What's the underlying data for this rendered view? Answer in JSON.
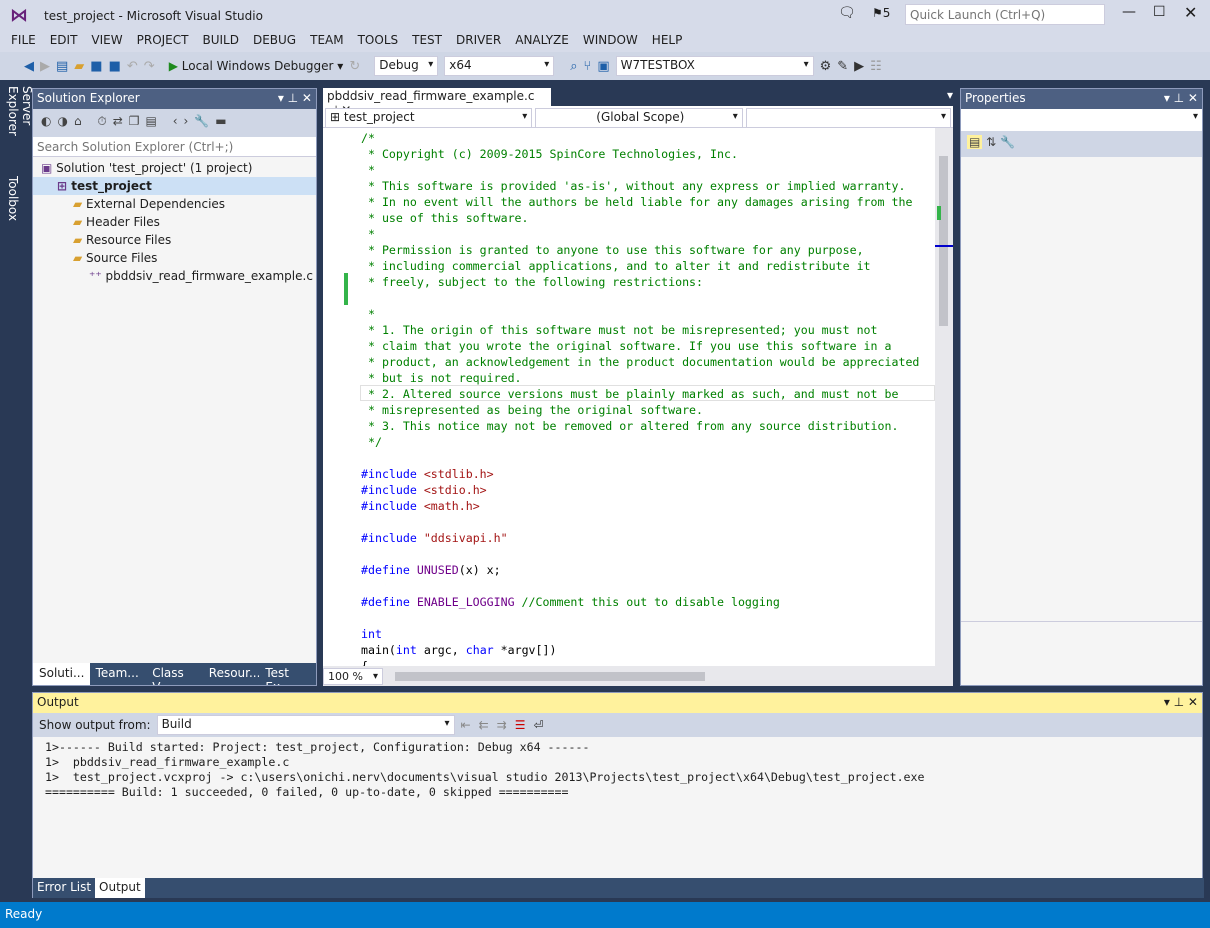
{
  "window": {
    "title": "test_project - Microsoft Visual Studio",
    "notifications": "5",
    "quick_launch_placeholder": "Quick Launch (Ctrl+Q)"
  },
  "menu": [
    "FILE",
    "EDIT",
    "VIEW",
    "PROJECT",
    "BUILD",
    "DEBUG",
    "TEAM",
    "TOOLS",
    "TEST",
    "DRIVER",
    "ANALYZE",
    "WINDOW",
    "HELP"
  ],
  "toolbar": {
    "debugger": "Local Windows Debugger",
    "config": "Debug",
    "platform": "x64",
    "target": "W7TESTBOX"
  },
  "side_tabs": [
    "Server Explorer",
    "Toolbox"
  ],
  "solution_explorer": {
    "title": "Solution Explorer",
    "search_placeholder": "Search Solution Explorer (Ctrl+;)",
    "tree": [
      {
        "label": "Solution 'test_project' (1 project)",
        "indent": 0
      },
      {
        "label": "test_project",
        "indent": 1,
        "selected": true
      },
      {
        "label": "External Dependencies",
        "indent": 2
      },
      {
        "label": "Header Files",
        "indent": 2
      },
      {
        "label": "Resource Files",
        "indent": 2
      },
      {
        "label": "Source Files",
        "indent": 2
      },
      {
        "label": "pbddsiv_read_firmware_example.c",
        "indent": 3
      }
    ],
    "tabs": [
      "Soluti...",
      "Team...",
      "Class V...",
      "Resour...",
      "Test Ex..."
    ]
  },
  "editor": {
    "tab": "pbddsiv_read_firmware_example.c",
    "nav_project": "test_project",
    "nav_scope": "(Global Scope)",
    "zoom": "100 %",
    "lines": [
      [
        [
          "/*",
          "cm"
        ]
      ],
      [
        [
          " * Copyright (c) 2009-2015 SpinCore Technologies, Inc.",
          "cm"
        ]
      ],
      [
        [
          " *",
          "cm"
        ]
      ],
      [
        [
          " * This software is provided 'as-is', without any express or implied warranty.",
          "cm"
        ]
      ],
      [
        [
          " * In no event will the authors be held liable for any damages arising from the",
          "cm"
        ]
      ],
      [
        [
          " * use of this software.",
          "cm"
        ]
      ],
      [
        [
          " *",
          "cm"
        ]
      ],
      [
        [
          " * Permission is granted to anyone to use this software for any purpose,",
          "cm"
        ]
      ],
      [
        [
          " * including commercial applications, and to alter it and redistribute it",
          "cm"
        ]
      ],
      [
        [
          " * freely, subject to the following restrictions:",
          "cm"
        ]
      ],
      [],
      [
        [
          " *",
          "cm"
        ]
      ],
      [
        [
          " * 1. The origin of this software must not be misrepresented; you must not",
          "cm"
        ]
      ],
      [
        [
          " * claim that you wrote the original software. If you use this software in a",
          "cm"
        ]
      ],
      [
        [
          " * product, an acknowledgement in the product documentation would be appreciated",
          "cm"
        ]
      ],
      [
        [
          " * but is not required.",
          "cm"
        ]
      ],
      [
        [
          " * 2. Altered source versions must be plainly marked as such, and must not be",
          "cm"
        ]
      ],
      [
        [
          " * misrepresented as being the original software.",
          "cm"
        ]
      ],
      [
        [
          " * 3. This notice may not be removed or altered from any source distribution.",
          "cm"
        ]
      ],
      [
        [
          " */",
          "cm"
        ]
      ],
      [],
      [
        [
          "#include ",
          "kw"
        ],
        [
          "<stdlib.h>",
          "st"
        ]
      ],
      [
        [
          "#include ",
          "kw"
        ],
        [
          "<stdio.h>",
          "st"
        ]
      ],
      [
        [
          "#include ",
          "kw"
        ],
        [
          "<math.h>",
          "st"
        ]
      ],
      [],
      [
        [
          "#include ",
          "kw"
        ],
        [
          "\"ddsivapi.h\"",
          "st"
        ]
      ],
      [],
      [
        [
          "#define ",
          "kw"
        ],
        [
          "UNUSED",
          "mc"
        ],
        [
          "(x) x;",
          "pl"
        ]
      ],
      [],
      [
        [
          "#define ",
          "kw"
        ],
        [
          "ENABLE_LOGGING",
          "mc"
        ],
        [
          " //Comment this out to disable logging",
          "cm"
        ]
      ],
      [],
      [
        [
          "int",
          "kw"
        ]
      ],
      [
        [
          "main(",
          "pl"
        ],
        [
          "int",
          "kw"
        ],
        [
          " argc, ",
          "pl"
        ],
        [
          "char",
          "kw"
        ],
        [
          " *argv[])",
          "pl"
        ]
      ],
      [
        [
          "{",
          "pl"
        ]
      ]
    ]
  },
  "properties": {
    "title": "Properties"
  },
  "output": {
    "title": "Output",
    "show_from_label": "Show output from:",
    "source": "Build",
    "lines": [
      "1>------ Build started: Project: test_project, Configuration: Debug x64 ------",
      "1>  pbddsiv_read_firmware_example.c",
      "1>  test_project.vcxproj -> c:\\users\\onichi.nerv\\documents\\visual studio 2013\\Projects\\test_project\\x64\\Debug\\test_project.exe",
      "========== Build: 1 succeeded, 0 failed, 0 up-to-date, 0 skipped =========="
    ],
    "tabs": [
      "Error List",
      "Output"
    ]
  },
  "status": {
    "text": "Ready"
  },
  "colors": {
    "status_bar": "#007acc",
    "output_header": "#fff29d",
    "accent_purple": "#68217a"
  }
}
